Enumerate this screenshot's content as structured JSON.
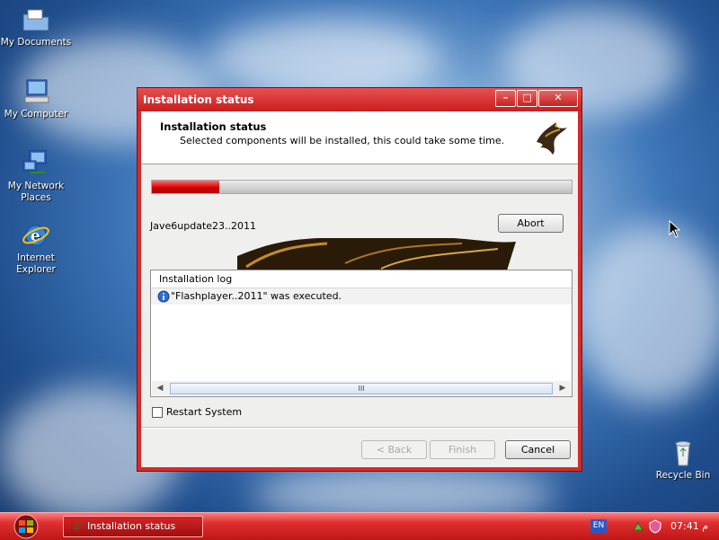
{
  "desktop": {
    "icons": [
      {
        "label": "My Documents"
      },
      {
        "label": "My Computer"
      },
      {
        "label": "My Network Places"
      },
      {
        "label": "Internet Explorer"
      },
      {
        "label": "Recycle Bin"
      }
    ]
  },
  "window": {
    "title": "Installation status",
    "controls": {
      "minimize": "–",
      "maximize": "□",
      "close": "✕"
    },
    "header_title": "Installation status",
    "header_subtitle": "Selected components will be installed, this could take some time.",
    "progress_fraction": 0.16,
    "status_text": "Jave6update23..2011",
    "abort_label": "Abort",
    "log": {
      "column_header": "Installation log",
      "rows": [
        {
          "text": "\"Flashplayer..2011\" was executed."
        }
      ],
      "scroll_thumb_grip": "III"
    },
    "restart_label": "Restart System",
    "restart_checked": false,
    "back_label": "< Back",
    "finish_label": "Finish",
    "cancel_label": "Cancel"
  },
  "taskbar": {
    "task_label": "Installation status",
    "language": "EN",
    "clock": "07:41 م"
  },
  "colors": {
    "accent": "#d62a2a",
    "progress_fill": "#d70000"
  }
}
